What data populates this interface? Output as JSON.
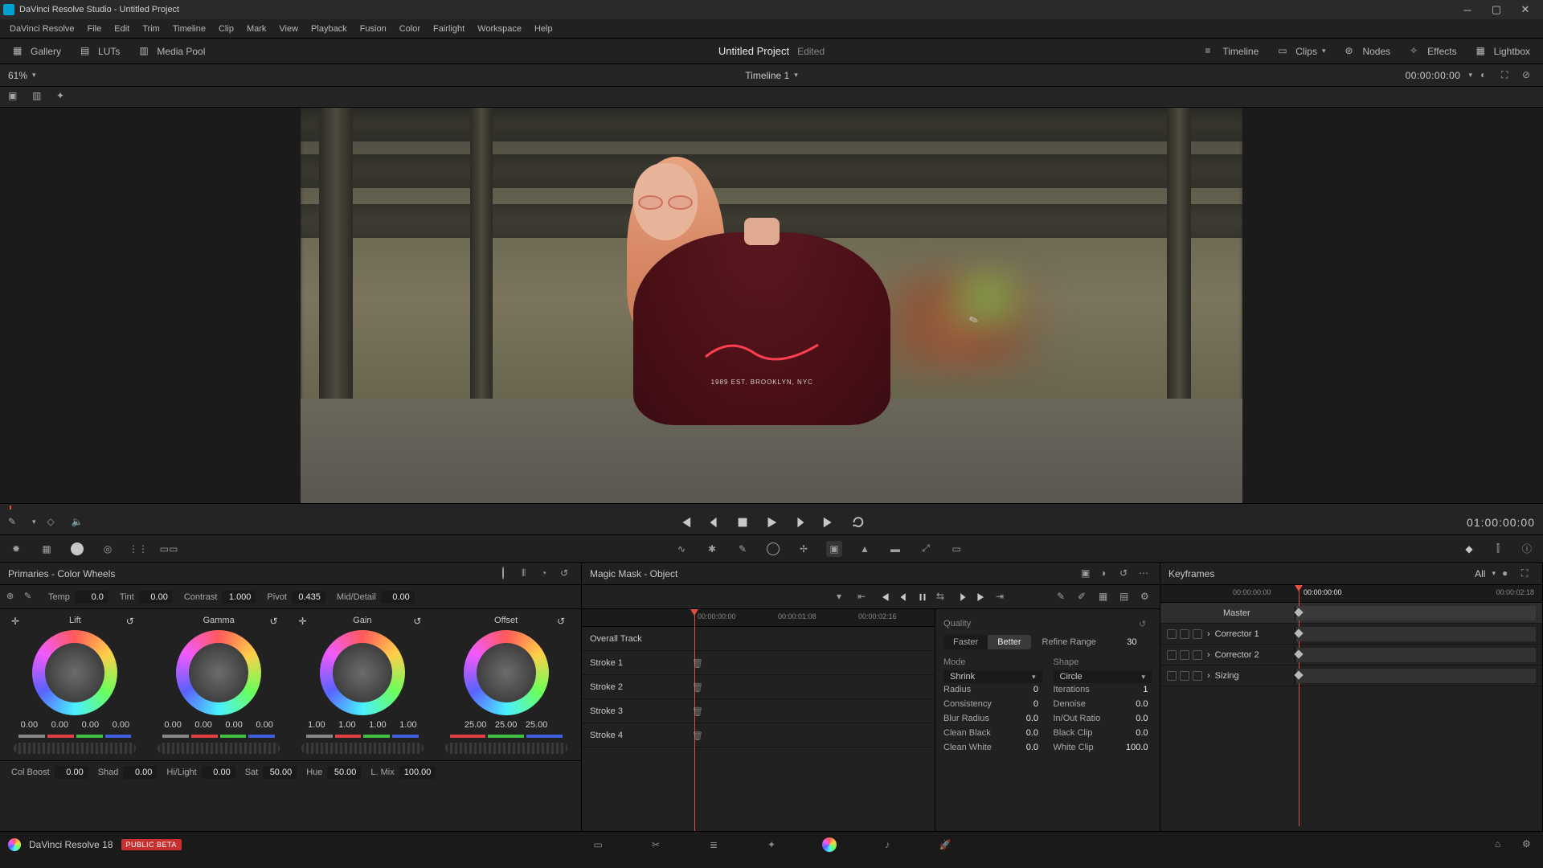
{
  "titlebar": {
    "text": "DaVinci Resolve Studio - Untitled Project"
  },
  "menu": [
    "DaVinci Resolve",
    "File",
    "Edit",
    "Trim",
    "Timeline",
    "Clip",
    "Mark",
    "View",
    "Playback",
    "Fusion",
    "Color",
    "Fairlight",
    "Workspace",
    "Help"
  ],
  "header": {
    "left": [
      "Gallery",
      "LUTs",
      "Media Pool"
    ],
    "project": "Untitled Project",
    "edited": "Edited",
    "right": [
      "Timeline",
      "Clips",
      "Nodes",
      "Effects",
      "Lightbox"
    ]
  },
  "viewer": {
    "zoom": "61%",
    "timeline_name": "Timeline 1",
    "tc_top": "00:00:00:00",
    "tc_play": "01:00:00:00",
    "shirt_text": "1989 EST. BROOKLYN, NYC"
  },
  "primaries": {
    "title": "Primaries - Color Wheels",
    "row1": {
      "temp_l": "Temp",
      "temp": "0.0",
      "tint_l": "Tint",
      "tint": "0.00",
      "contrast_l": "Contrast",
      "contrast": "1.000",
      "pivot_l": "Pivot",
      "pivot": "0.435",
      "md_l": "Mid/Detail",
      "md": "0.00"
    },
    "wheels": [
      {
        "name": "Lift",
        "vals": [
          "0.00",
          "0.00",
          "0.00",
          "0.00"
        ]
      },
      {
        "name": "Gamma",
        "vals": [
          "0.00",
          "0.00",
          "0.00",
          "0.00"
        ]
      },
      {
        "name": "Gain",
        "vals": [
          "1.00",
          "1.00",
          "1.00",
          "1.00"
        ]
      },
      {
        "name": "Offset",
        "vals": [
          "25.00",
          "25.00",
          "25.00"
        ]
      }
    ],
    "row2": {
      "cb_l": "Col Boost",
      "cb": "0.00",
      "shad_l": "Shad",
      "shad": "0.00",
      "hl_l": "Hi/Light",
      "hl": "0.00",
      "sat_l": "Sat",
      "sat": "50.00",
      "hue_l": "Hue",
      "hue": "50.00",
      "lm_l": "L. Mix",
      "lm": "100.00"
    }
  },
  "magicmask": {
    "title": "Magic Mask - Object",
    "ruler": [
      "00:00:00:00",
      "00:00:01:08",
      "00:00:02:16"
    ],
    "tracks": [
      "Overall Track",
      "Stroke 1",
      "Stroke 2",
      "Stroke 3",
      "Stroke 4"
    ],
    "quality_l": "Quality",
    "faster": "Faster",
    "better": "Better",
    "refine_l": "Refine Range",
    "refine": "30",
    "mode_l": "Mode",
    "shape_l": "Shape",
    "mode_v": "Shrink",
    "shape_v": "Circle",
    "radius_l": "Radius",
    "radius": "0",
    "iter_l": "Iterations",
    "iter": "1",
    "cons_l": "Consistency",
    "cons": "0",
    "den_l": "Denoise",
    "den": "0.0",
    "blur_l": "Blur Radius",
    "blur": "0.0",
    "io_l": "In/Out Ratio",
    "io": "0.0",
    "cb_l": "Clean Black",
    "cb": "0.0",
    "bc_l": "Black Clip",
    "bc": "0.0",
    "cw_l": "Clean White",
    "cw": "0.0",
    "wc_l": "White Clip",
    "wc": "100.0"
  },
  "keyframes": {
    "title": "Keyframes",
    "all": "All",
    "ruler": [
      "00:00:00:00",
      "00:00:00:00",
      "00:00:02:18"
    ],
    "rows": [
      "Master",
      "Corrector 1",
      "Corrector 2",
      "Sizing"
    ]
  },
  "bottom": {
    "app": "DaVinci Resolve 18",
    "beta": "PUBLIC BETA"
  }
}
